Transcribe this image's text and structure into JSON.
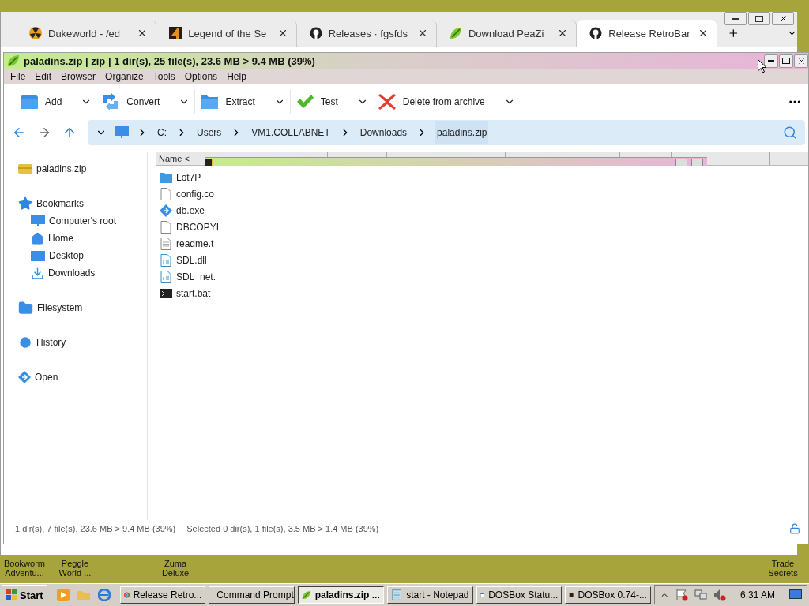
{
  "desktop": {
    "icons": [
      {
        "label": "Bookworm Adventu..."
      },
      {
        "label": "Peggle World ..."
      },
      {
        "label": "Zuma Deluxe"
      },
      {
        "label": "Trade Secrets"
      }
    ]
  },
  "browser": {
    "tabs": [
      {
        "title": "Dukeworld - /ed",
        "kind": "radiation",
        "selected": false
      },
      {
        "title": "Legend of the Se",
        "kind": "game",
        "selected": false
      },
      {
        "title": "Releases · fgsfds",
        "kind": "github",
        "selected": false
      },
      {
        "title": "Download PeaZi",
        "kind": "leaf",
        "selected": false
      },
      {
        "title": "Release RetroBar",
        "kind": "github",
        "selected": true
      }
    ]
  },
  "archiver": {
    "title": "paladins.zip | zip | 1 dir(s), 25 file(s), 23.6 MB > 9.4 MB (39%)",
    "menu": [
      "File",
      "Edit",
      "Browser",
      "Organize",
      "Tools",
      "Options",
      "Help"
    ],
    "toolbar": [
      {
        "label": "Add",
        "kind": "add"
      },
      {
        "label": "Convert",
        "kind": "convert"
      },
      {
        "label": "Extract",
        "kind": "extract"
      },
      {
        "label": "Test",
        "kind": "test"
      },
      {
        "label": "Delete from archive",
        "kind": "delete"
      }
    ],
    "path": [
      {
        "label": "C:",
        "selected": false
      },
      {
        "label": "Users",
        "selected": false
      },
      {
        "label": "VM1.COLLABNET",
        "selected": false
      },
      {
        "label": "Downloads",
        "selected": false
      },
      {
        "label": "paladins.zip",
        "selected": true
      }
    ],
    "sidebar": [
      {
        "label": "paladins.zip",
        "kind": "archive"
      },
      {
        "label": "Bookmarks",
        "kind": "star",
        "children": [
          {
            "label": "Computer's root",
            "kind": "monitor"
          },
          {
            "label": "Home",
            "kind": "home"
          },
          {
            "label": "Desktop",
            "kind": "desktop"
          },
          {
            "label": "Downloads",
            "kind": "download"
          }
        ]
      },
      {
        "label": "Filesystem",
        "kind": "folder"
      },
      {
        "label": "History",
        "kind": "history"
      },
      {
        "label": "Open",
        "kind": "open"
      }
    ],
    "column": "Name <",
    "files": [
      {
        "name": "Lot7P",
        "kind": "folder"
      },
      {
        "name": "config.co",
        "kind": "file"
      },
      {
        "name": "db.exe",
        "kind": "exe"
      },
      {
        "name": "DBCOPYI",
        "kind": "file"
      },
      {
        "name": "readme.t",
        "kind": "text"
      },
      {
        "name": "SDL.dll",
        "kind": "dll"
      },
      {
        "name": "SDL_net.",
        "kind": "dll"
      },
      {
        "name": "start.bat",
        "kind": "bat"
      }
    ],
    "status": [
      "1 dir(s), 7 file(s), 23.6 MB > 9.4 MB (39%)",
      "Selected 0 dir(s), 1 file(s), 3.5 MB > 1.4 MB (39%)"
    ]
  },
  "taskbar": {
    "start": "Start",
    "tasks": [
      {
        "label": "Release Retro...",
        "kind": "chrome",
        "selected": false
      },
      {
        "label": "Command Prompt",
        "kind": "cmd",
        "selected": false
      },
      {
        "label": "paladins.zip ...",
        "kind": "leaf",
        "selected": true
      },
      {
        "label": "start - Notepad",
        "kind": "notepad",
        "selected": false
      },
      {
        "label": "DOSBox Statu...",
        "kind": "window",
        "selected": false
      },
      {
        "label": "DOSBox 0.74-...",
        "kind": "dosbox",
        "selected": false
      }
    ],
    "clock": "6:31 AM"
  }
}
